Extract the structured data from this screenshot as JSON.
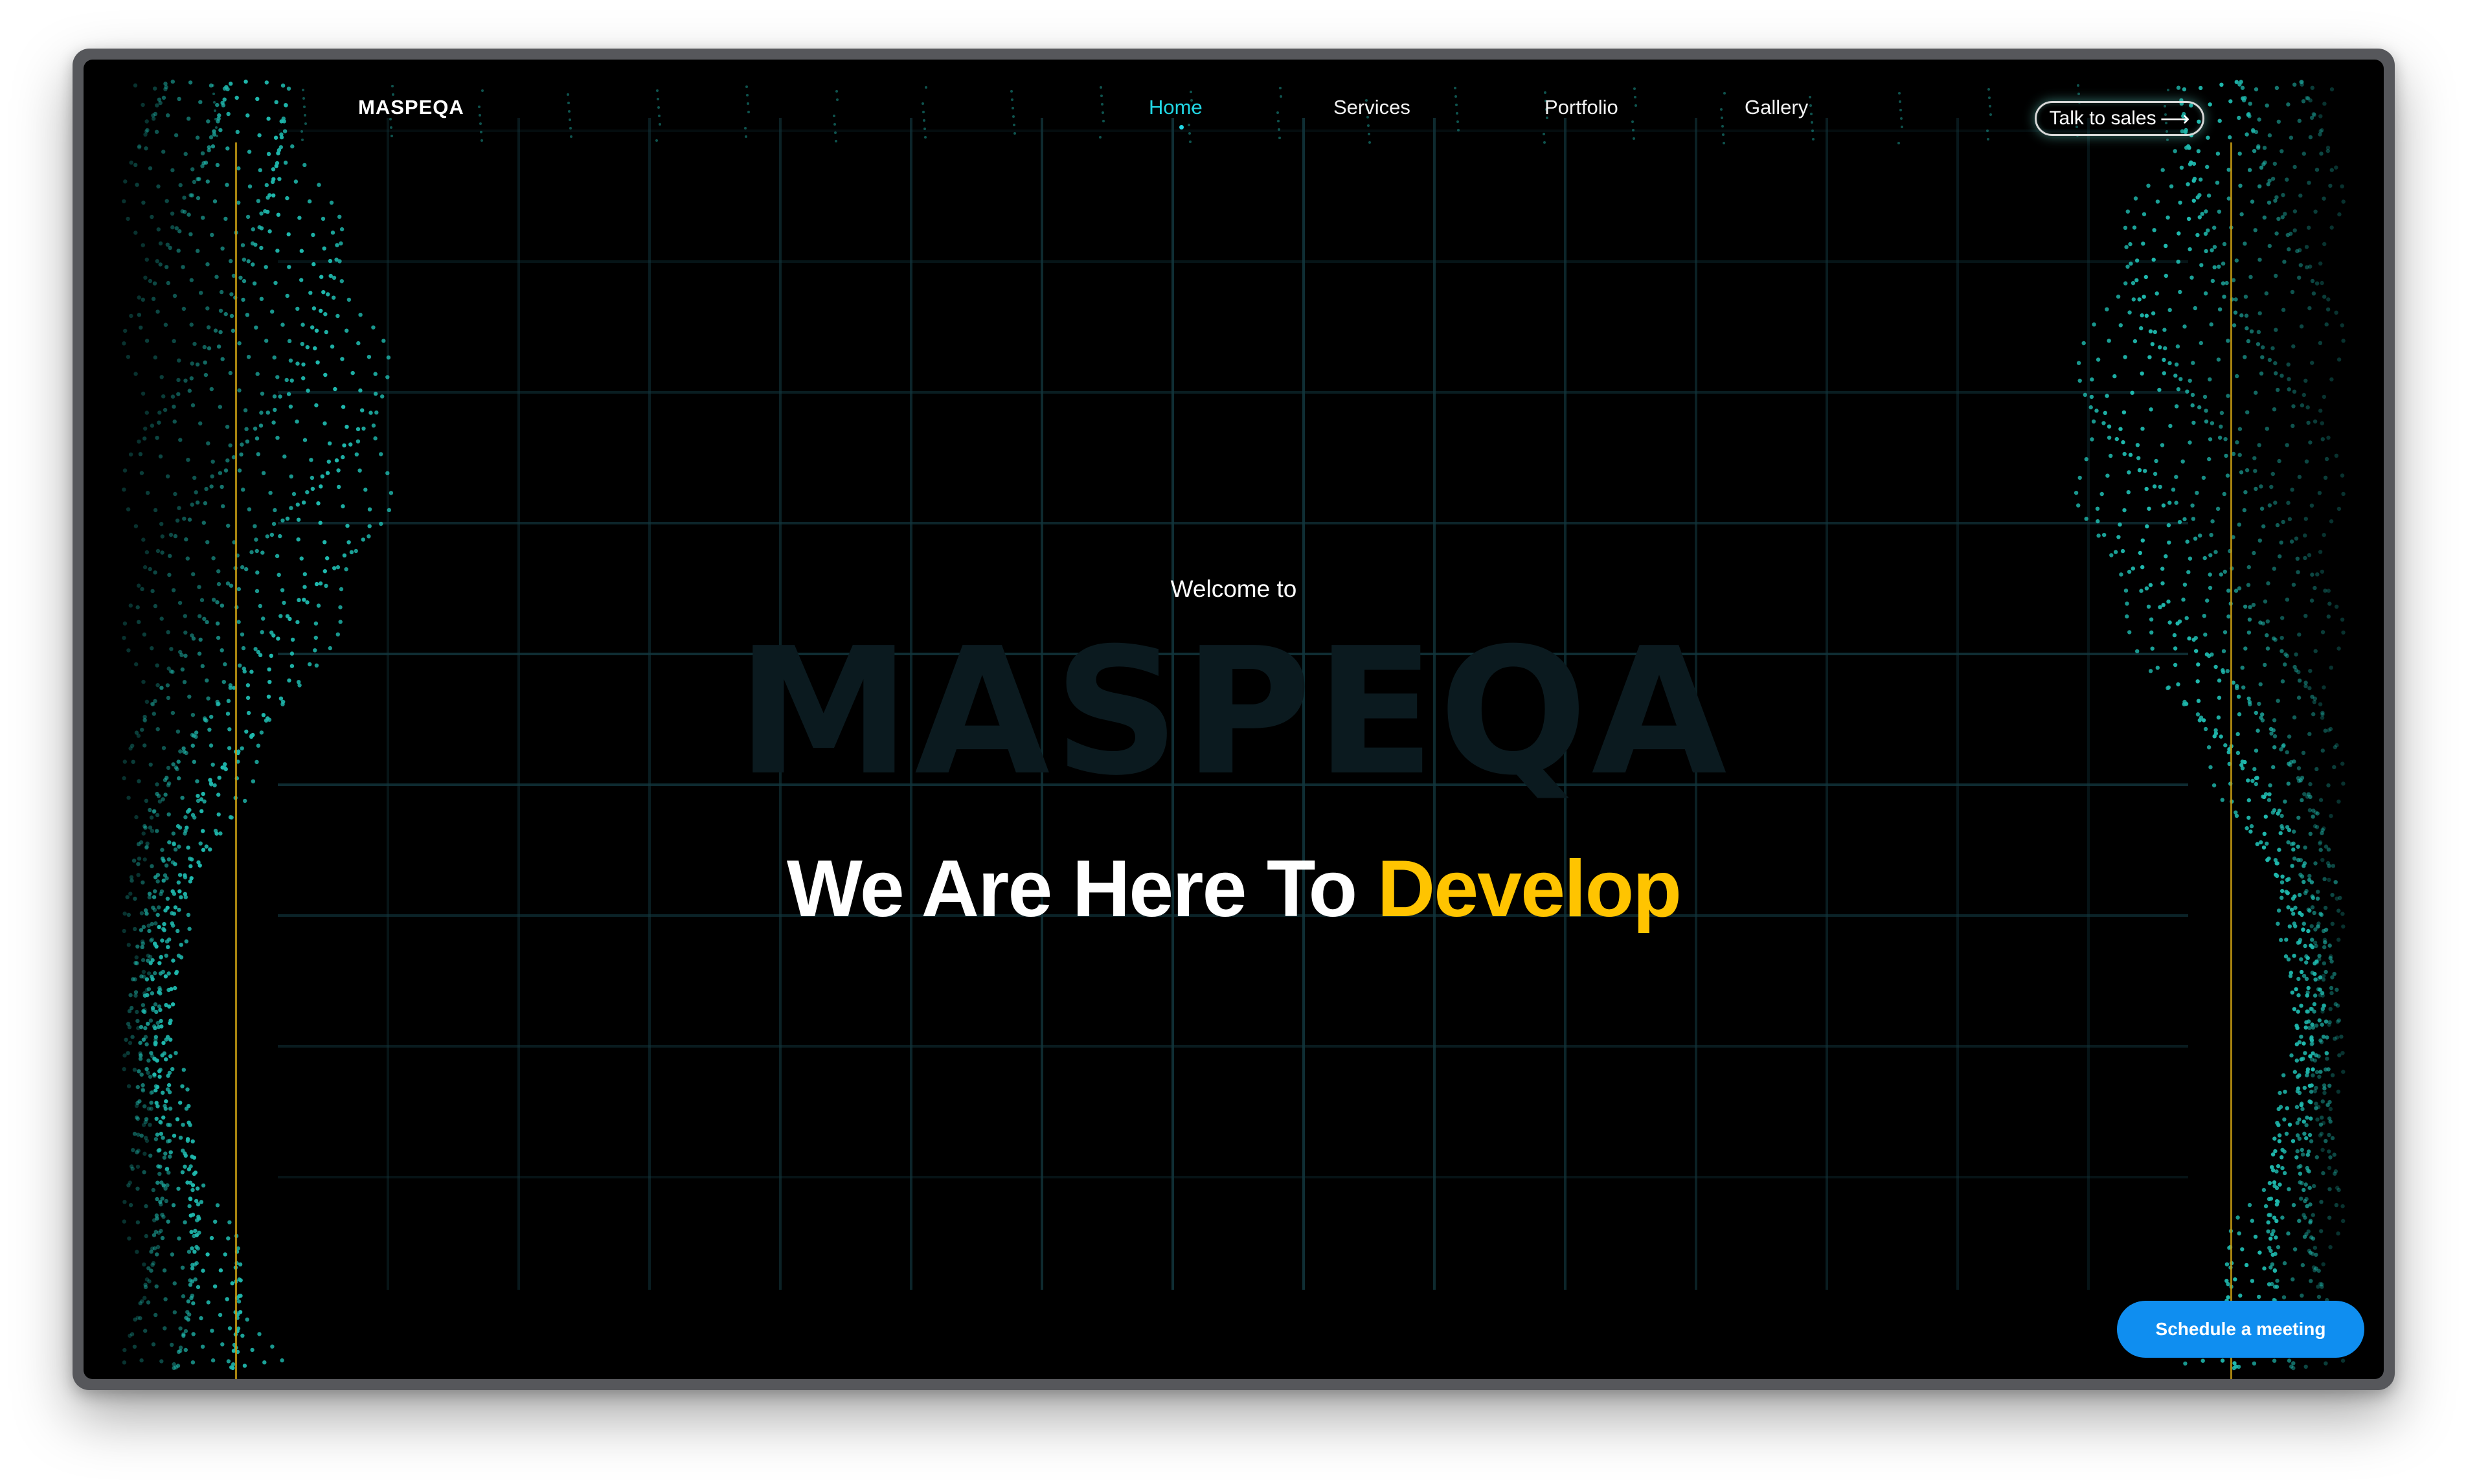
{
  "brand": {
    "logo_text": "MASPEQA"
  },
  "nav": {
    "items": [
      {
        "label": "Home",
        "active": true
      },
      {
        "label": "Services",
        "active": false
      },
      {
        "label": "Portfolio",
        "active": false
      },
      {
        "label": "Gallery",
        "active": false
      }
    ],
    "cta_label": "Talk to sales",
    "cta_icon": "arrow-right-icon"
  },
  "hero": {
    "welcome": "Welcome to",
    "background_word": "MASPEQA",
    "headline_prefix": "We Are Here To ",
    "headline_accent": "Develop"
  },
  "floating_cta": {
    "label": "Schedule a meeting"
  },
  "colors": {
    "background": "#000000",
    "active_nav": "#21d6e4",
    "accent_yellow": "#ffc400",
    "particle_teal": "#1fb8ad",
    "grid_line": "#12363d",
    "schedule_button": "#0f8ef0",
    "frame_line": "#c49a12"
  }
}
